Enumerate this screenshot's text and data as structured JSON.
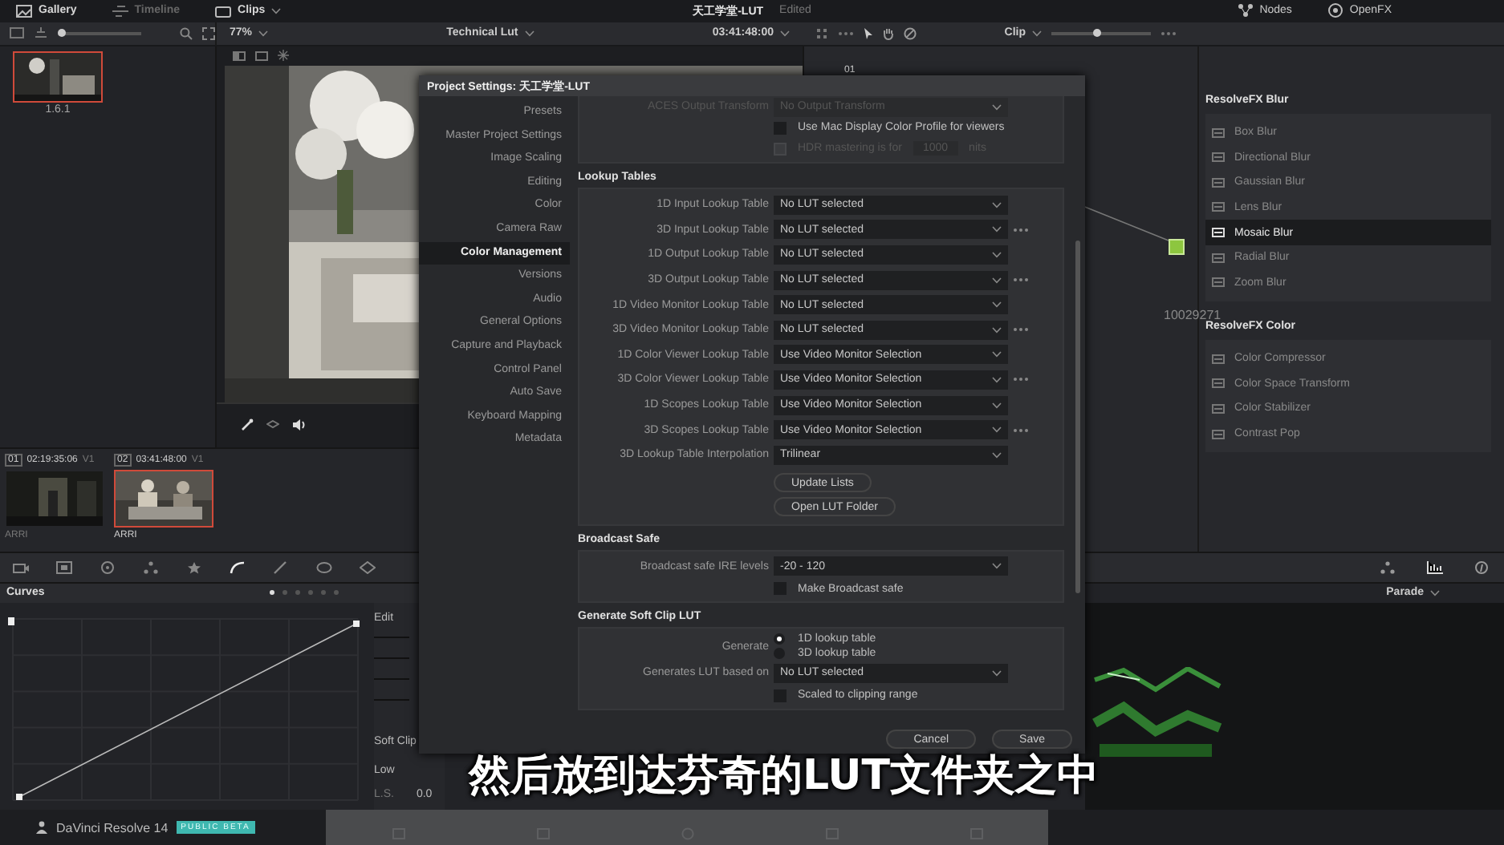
{
  "top_bar": {
    "tabs": [
      {
        "label": "Gallery",
        "on": true
      },
      {
        "label": "Timeline",
        "on": false
      },
      {
        "label": "Clips",
        "on": true
      }
    ],
    "project_title": "天工学堂-LUT",
    "project_status": "Edited",
    "panels": [
      {
        "label": "Nodes"
      },
      {
        "label": "OpenFX"
      }
    ]
  },
  "gallery_toolbar": {
    "zoom_slider": {
      "level": 0.03
    }
  },
  "viewer_toolbar": {
    "zoom": "77%",
    "title": "Technical Lut",
    "timecode": "03:41:48:00",
    "mode": "Clip",
    "mode_slider": {
      "level": 0.45
    }
  },
  "gallery": {
    "stills": [
      {
        "label": "1.6.1",
        "selected": true
      }
    ]
  },
  "clips": [
    {
      "number": "01",
      "timecode": "02:19:35:06",
      "track": "V1",
      "label": "ARRI",
      "selected": false
    },
    {
      "number": "02",
      "timecode": "03:41:48:00",
      "track": "V1",
      "label": "ARRI",
      "selected": true
    }
  ],
  "node_graph": {
    "node_label": "01",
    "output_label": "10029271"
  },
  "library": {
    "groups": [
      {
        "title": "ResolveFX Blur",
        "items": [
          {
            "label": "Box Blur",
            "selected": false
          },
          {
            "label": "Directional Blur",
            "selected": false
          },
          {
            "label": "Gaussian Blur",
            "selected": false
          },
          {
            "label": "Lens Blur",
            "selected": false
          },
          {
            "label": "Mosaic Blur",
            "selected": true
          },
          {
            "label": "Radial Blur",
            "selected": false
          },
          {
            "label": "Zoom Blur",
            "selected": false
          }
        ]
      },
      {
        "title": "ResolveFX Color",
        "items": [
          {
            "label": "Color Compressor",
            "selected": false
          },
          {
            "label": "Color Space Transform",
            "selected": false
          },
          {
            "label": "Color Stabilizer",
            "selected": false
          },
          {
            "label": "Contrast Pop",
            "selected": false
          }
        ]
      }
    ]
  },
  "curves": {
    "title": "Curves",
    "edit_label": "Edit",
    "soft_clip_label": "Soft Clip",
    "low_label": "Low",
    "ls_label": "L.S.",
    "ls_value": "0.0"
  },
  "scopes": {
    "mode": "Parade"
  },
  "footer": {
    "app_name": "DaVinci Resolve 14",
    "badge": "PUBLIC BETA"
  },
  "dialog": {
    "title": "Project Settings:  天工学堂-LUT",
    "sidebar": [
      {
        "label": "Presets",
        "selected": false
      },
      {
        "label": "Master Project Settings",
        "selected": false
      },
      {
        "label": "Image Scaling",
        "selected": false
      },
      {
        "label": "Editing",
        "selected": false
      },
      {
        "label": "Color",
        "selected": false
      },
      {
        "label": "Camera Raw",
        "selected": false
      },
      {
        "label": "Color Management",
        "selected": true
      },
      {
        "label": "Versions",
        "selected": false
      },
      {
        "label": "Audio",
        "selected": false
      },
      {
        "label": "General Options",
        "selected": false
      },
      {
        "label": "Capture and Playback",
        "selected": false
      },
      {
        "label": "Control Panel",
        "selected": false
      },
      {
        "label": "Auto Save",
        "selected": false
      },
      {
        "label": "Keyboard Mapping",
        "selected": false
      },
      {
        "label": "Metadata",
        "selected": false
      }
    ],
    "sections": [
      {
        "rows": [
          {
            "kind": "dropdown",
            "label": "ACES Output Transform",
            "value": "No Output Transform",
            "disabled": true,
            "more": false
          },
          {
            "kind": "checkbox",
            "label": "Use Mac Display Color Profile for viewers",
            "checked": false,
            "disabled": false
          },
          {
            "kind": "checkbox",
            "label": "HDR mastering is for",
            "value": "1000",
            "unit": "nits",
            "checked": false,
            "disabled": true
          }
        ]
      },
      {
        "title": "Lookup Tables",
        "rows": [
          {
            "kind": "dropdown",
            "label": "1D Input Lookup Table",
            "value": "No LUT selected",
            "disabled": false,
            "more": false
          },
          {
            "kind": "dropdown",
            "label": "3D Input Lookup Table",
            "value": "No LUT selected",
            "disabled": false,
            "more": true
          },
          {
            "kind": "dropdown",
            "label": "1D Output Lookup Table",
            "value": "No LUT selected",
            "disabled": false,
            "more": false
          },
          {
            "kind": "dropdown",
            "label": "3D Output Lookup Table",
            "value": "No LUT selected",
            "disabled": false,
            "more": true
          },
          {
            "kind": "dropdown",
            "label": "1D Video Monitor Lookup Table",
            "value": "No LUT selected",
            "disabled": false,
            "more": false
          },
          {
            "kind": "dropdown",
            "label": "3D Video Monitor Lookup Table",
            "value": "No LUT selected",
            "disabled": false,
            "more": true
          },
          {
            "kind": "dropdown",
            "label": "1D Color Viewer Lookup Table",
            "value": "Use Video Monitor Selection",
            "disabled": false,
            "more": false
          },
          {
            "kind": "dropdown",
            "label": "3D Color Viewer Lookup Table",
            "value": "Use Video Monitor Selection",
            "disabled": false,
            "more": true
          },
          {
            "kind": "dropdown",
            "label": "1D Scopes Lookup Table",
            "value": "Use Video Monitor Selection",
            "disabled": false,
            "more": false
          },
          {
            "kind": "dropdown",
            "label": "3D Scopes Lookup Table",
            "value": "Use Video Monitor Selection",
            "disabled": false,
            "more": true
          },
          {
            "kind": "dropdown",
            "label": "3D Lookup Table Interpolation",
            "value": "Trilinear",
            "disabled": false,
            "more": false
          },
          {
            "kind": "buttons",
            "buttons": [
              "Update Lists",
              "Open LUT Folder"
            ]
          }
        ]
      },
      {
        "title": "Broadcast Safe",
        "rows": [
          {
            "kind": "dropdown",
            "label": "Broadcast safe IRE levels",
            "value": "-20 - 120",
            "disabled": false,
            "more": false
          },
          {
            "kind": "checkbox",
            "label": "Make Broadcast safe",
            "checked": false,
            "disabled": false
          }
        ]
      },
      {
        "title": "Generate Soft Clip LUT",
        "rows": [
          {
            "kind": "radio",
            "label": "Generate",
            "options": [
              {
                "label": "1D lookup table",
                "selected": true
              },
              {
                "label": "3D lookup table",
                "selected": false
              }
            ]
          },
          {
            "kind": "dropdown",
            "label": "Generates LUT based on",
            "value": "No LUT selected",
            "disabled": false,
            "more": false
          },
          {
            "kind": "checkbox",
            "label": "Scaled to clipping range",
            "checked": false,
            "disabled": false
          }
        ]
      }
    ],
    "buttons": [
      "Cancel",
      "Save"
    ]
  },
  "subtitle": "然后放到达芬奇的LUT文件夹之中"
}
